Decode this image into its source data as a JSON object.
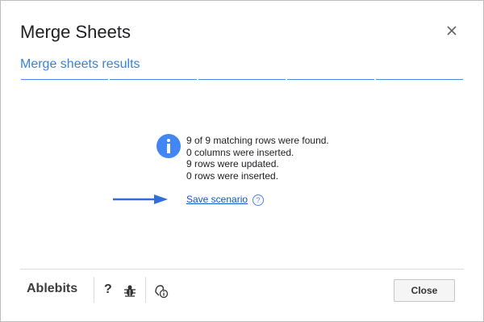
{
  "dialog": {
    "title": "Merge Sheets",
    "subtitle": "Merge sheets results",
    "progress_segments": 5
  },
  "results": {
    "messages": [
      "9 of 9 matching rows were found.",
      "0 columns were inserted.",
      "9 rows were updated.",
      "0 rows were inserted."
    ],
    "save_link": "Save scenario",
    "help_glyph": "?"
  },
  "footer": {
    "brand": "Ablebits",
    "help_glyph": "?",
    "close_button": "Close"
  },
  "colors": {
    "accent": "#4285f4",
    "link": "#1155cc",
    "arrow": "#2f6fd6"
  },
  "icons": [
    "close-icon",
    "info-icon",
    "arrow-icon",
    "help-icon",
    "bug-icon",
    "feedback-icon"
  ]
}
